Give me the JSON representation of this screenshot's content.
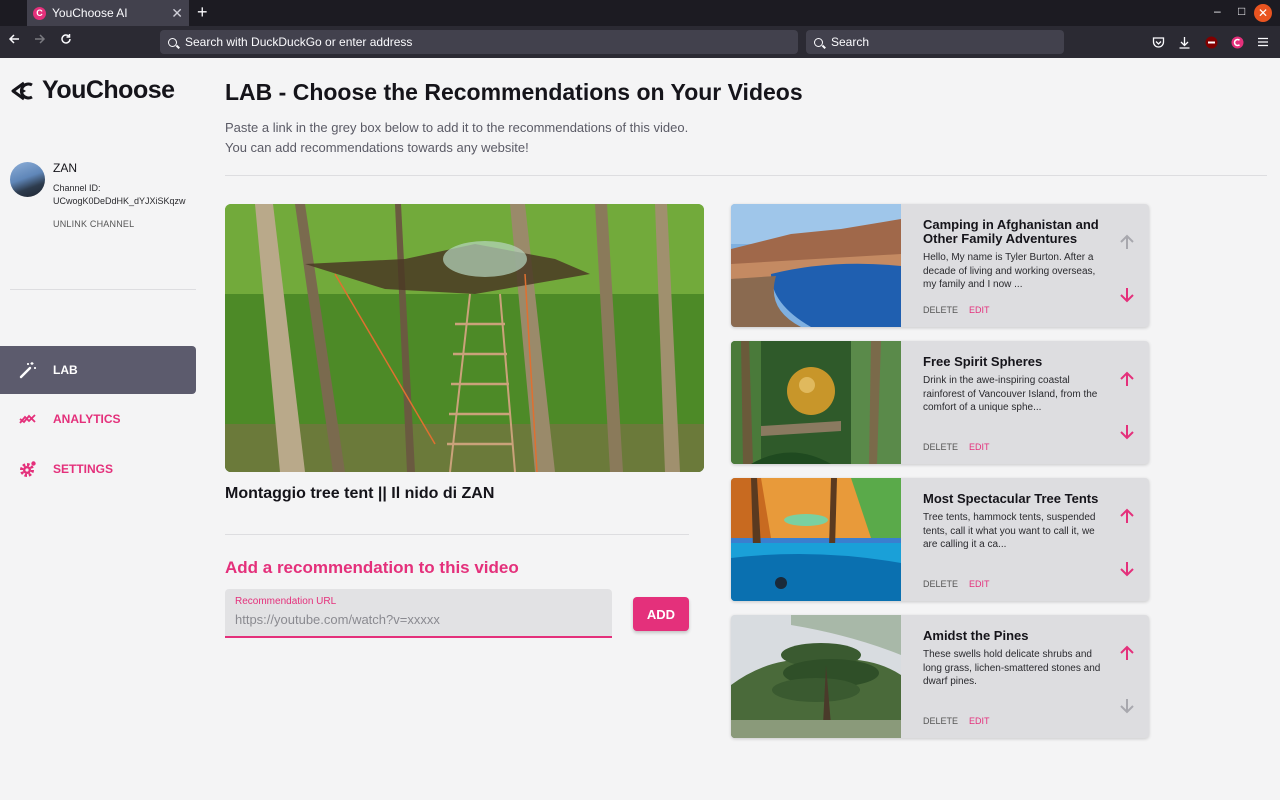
{
  "browser": {
    "tab_title": "YouChoose AI",
    "tab_favicon": "C",
    "tab_close": "✕",
    "new_tab": "+",
    "address_placeholder": "Search with DuckDuckGo or enter address",
    "search_placeholder": "Search",
    "minimize": "–",
    "maximize": "□",
    "close": "✕"
  },
  "app": {
    "brand": "YouChoose",
    "accent_color": "#e4307b"
  },
  "profile": {
    "name": "ZAN",
    "channel_label": "Channel ID:",
    "channel_id": "UCwogK0DeDdHK_dYJXiSKqzw",
    "unlink": "UNLINK CHANNEL"
  },
  "sidebar": {
    "items": [
      {
        "label": "LAB",
        "icon": "magic-wand-icon",
        "active": true
      },
      {
        "label": "ANALYTICS",
        "icon": "trend-icon",
        "active": false
      },
      {
        "label": "SETTINGS",
        "icon": "gear-icon",
        "active": false
      }
    ]
  },
  "page": {
    "title": "LAB - Choose the Recommendations on Your Videos",
    "subtitle_1": "Paste a link in the grey box below to add it to the recommendations of this video.",
    "subtitle_2": "You can add recommendations towards any website!"
  },
  "video": {
    "title": "Montaggio tree tent || Il nido di ZAN"
  },
  "add_form": {
    "heading": "Add a recommendation to this video",
    "field_label": "Recommendation URL",
    "placeholder": "https://youtube.com/watch?v=xxxxx",
    "button": "ADD"
  },
  "recommendations": [
    {
      "title": "Camping in Afghanistan and Other Family Adventures",
      "description": "Hello, My name is Tyler Burton.  After a decade of living and working overseas, my family and I now ...",
      "delete": "DELETE",
      "edit": "EDIT",
      "can_move_up": false,
      "can_move_down": true
    },
    {
      "title": "Free Spirit Spheres",
      "description": "Drink in the awe-inspiring coastal rainforest of Vancouver Island, from the comfort of a unique sphe...",
      "delete": "DELETE",
      "edit": "EDIT",
      "can_move_up": true,
      "can_move_down": true
    },
    {
      "title": "Most Spectacular Tree Tents",
      "description": "Tree tents, hammock tents, suspended tents, call it what you want to call it, we are calling it a ca...",
      "delete": "DELETE",
      "edit": "EDIT",
      "can_move_up": true,
      "can_move_down": true
    },
    {
      "title": "Amidst the Pines",
      "description": "These swells hold delicate shrubs and long grass, lichen-smattered stones and dwarf pines.",
      "delete": "DELETE",
      "edit": "EDIT",
      "can_move_up": true,
      "can_move_down": false
    }
  ]
}
